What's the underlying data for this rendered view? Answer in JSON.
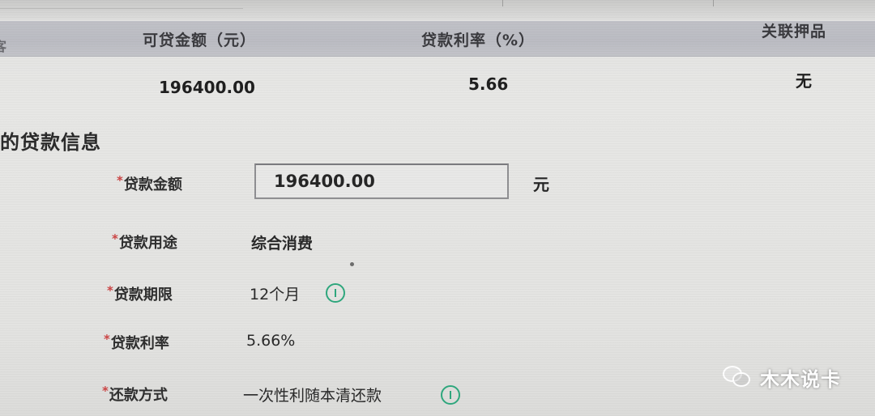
{
  "table": {
    "clipped_header": "客",
    "headers": [
      "可贷金额（元）",
      "贷款利率（%）",
      "关联押品"
    ],
    "row": [
      "196400.00",
      "5.66",
      "无"
    ]
  },
  "section": {
    "title": "的贷款信息"
  },
  "form": {
    "required_mark": "*",
    "amount": {
      "label": "贷款金额",
      "value": "196400.00",
      "unit": "元"
    },
    "purpose": {
      "label": "贷款用途",
      "value": "综合消费"
    },
    "term": {
      "label": "贷款期限",
      "value": "12个月",
      "info_icon": "info-icon"
    },
    "rate": {
      "label": "贷款利率",
      "value": "5.66%"
    },
    "repayment": {
      "label": "还款方式",
      "value": "一次性利随本清还款",
      "info_icon": "info-icon"
    }
  },
  "watermark": {
    "text": "木木说卡",
    "icon": "wechat-logo-icon"
  },
  "colors": {
    "header_bg": "#bfc0c6",
    "info_icon": "#2fa87e",
    "required": "#cc4444"
  }
}
